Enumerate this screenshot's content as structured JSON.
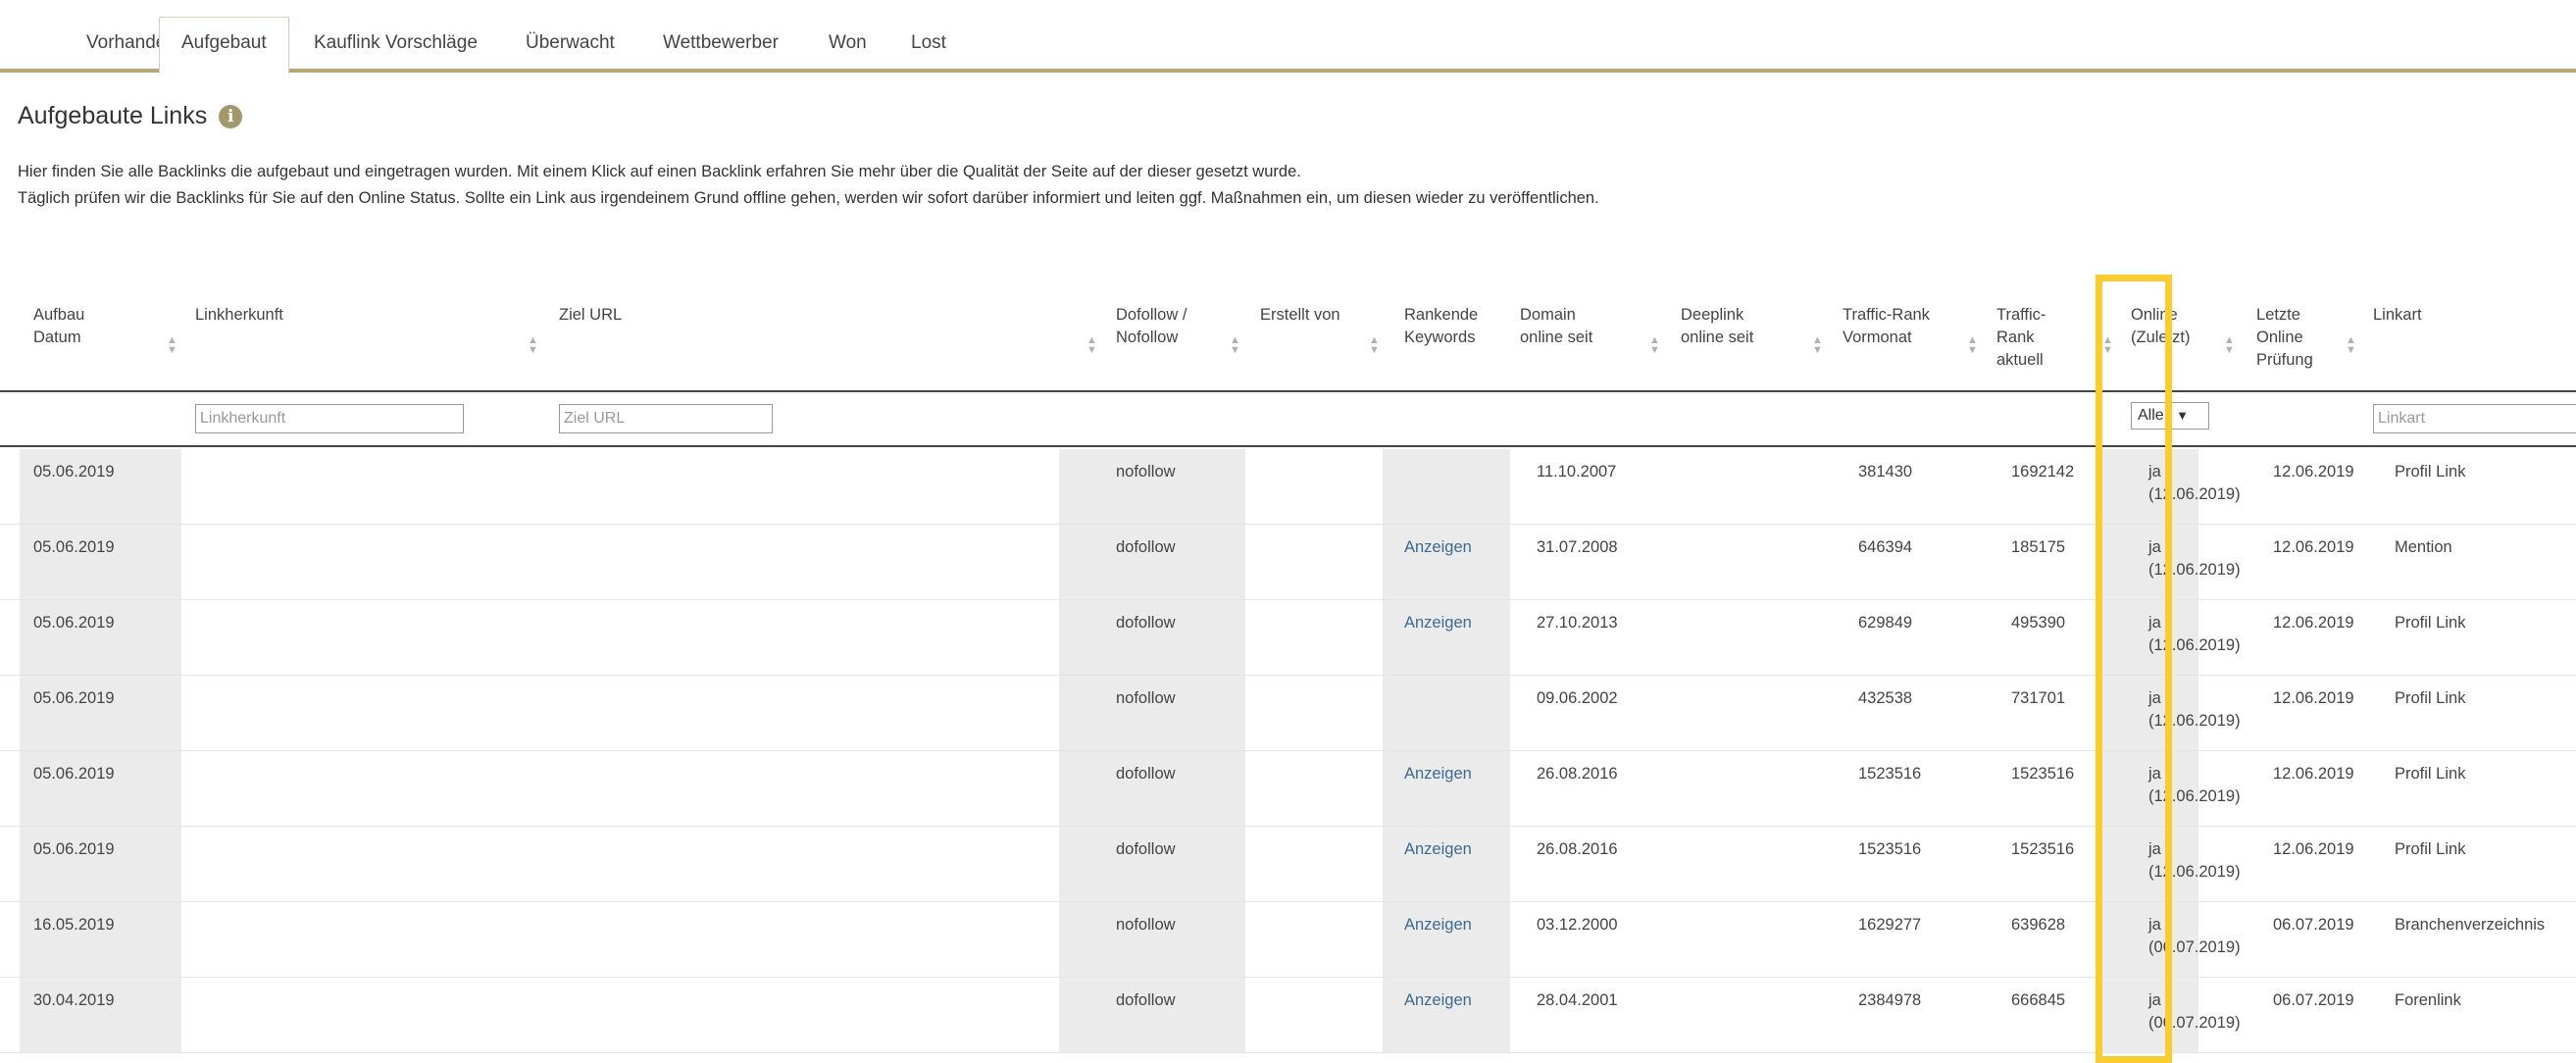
{
  "tabs": [
    {
      "label": "Vorhanden",
      "active": false
    },
    {
      "label": "Aufgebaut",
      "active": true
    },
    {
      "label": "Kauflink Vorschläge",
      "active": false
    },
    {
      "label": "Überwacht",
      "active": false
    },
    {
      "label": "Wettbewerber",
      "active": false
    },
    {
      "label": "Won",
      "active": false
    },
    {
      "label": "Lost",
      "active": false
    }
  ],
  "page": {
    "title": "Aufgebaute Links",
    "info_icon": "info-icon",
    "description_line1": "Hier finden Sie alle Backlinks die aufgebaut und eingetragen wurden. Mit einem Klick auf einen Backlink erfahren Sie mehr über die Qualität der Seite auf der dieser gesetzt wurde.",
    "description_line2": "Täglich prüfen wir die Backlinks für Sie auf den Online Status. Sollte ein Link aus irgendeinem Grund offline gehen, werden wir sofort darüber informiert und leiten ggf. Maßnahmen ein, um diesen wieder zu veröffentlichen."
  },
  "columns": [
    {
      "key": "aufbau",
      "label": "Aufbau\nDatum"
    },
    {
      "key": "herkunft",
      "label": "Linkherkunft"
    },
    {
      "key": "ziel",
      "label": "Ziel URL"
    },
    {
      "key": "follow",
      "label": "Dofollow /\nNofollow"
    },
    {
      "key": "erstellt",
      "label": "Erstellt von"
    },
    {
      "key": "keywords",
      "label": "Rankende\nKeywords"
    },
    {
      "key": "domain",
      "label": "Domain\nonline seit"
    },
    {
      "key": "deeplink",
      "label": "Deeplink\nonline seit"
    },
    {
      "key": "tr_vormonat",
      "label": "Traffic-Rank\nVormonat"
    },
    {
      "key": "tr_aktuell",
      "label": "Traffic-\nRank\naktuell"
    },
    {
      "key": "online",
      "label": "Online\n(Zuletzt)"
    },
    {
      "key": "pruefung",
      "label": "Letzte\nOnline\nPrüfung"
    },
    {
      "key": "linkart",
      "label": "Linkart"
    }
  ],
  "filters": {
    "herkunft_placeholder": "Linkherkunft",
    "ziel_placeholder": "Ziel URL",
    "online_selected": "Alle",
    "linkart_placeholder": "Linkart"
  },
  "rows": [
    {
      "aufbau": "05.06.2019",
      "follow": "nofollow",
      "keywords": "",
      "domain": "11.10.2007",
      "tr_vormonat": "381430",
      "tr_aktuell": "1692142",
      "online": "ja\n(12.06.2019)",
      "pruefung": "12.06.2019",
      "linkart": "Profil Link"
    },
    {
      "aufbau": "05.06.2019",
      "follow": "dofollow",
      "keywords": "Anzeigen",
      "domain": "31.07.2008",
      "tr_vormonat": "646394",
      "tr_aktuell": "185175",
      "online": "ja\n(12.06.2019)",
      "pruefung": "12.06.2019",
      "linkart": "Mention"
    },
    {
      "aufbau": "05.06.2019",
      "follow": "dofollow",
      "keywords": "Anzeigen",
      "domain": "27.10.2013",
      "tr_vormonat": "629849",
      "tr_aktuell": "495390",
      "online": "ja\n(12.06.2019)",
      "pruefung": "12.06.2019",
      "linkart": "Profil Link"
    },
    {
      "aufbau": "05.06.2019",
      "follow": "nofollow",
      "keywords": "",
      "domain": "09.06.2002",
      "tr_vormonat": "432538",
      "tr_aktuell": "731701",
      "online": "ja\n(12.06.2019)",
      "pruefung": "12.06.2019",
      "linkart": "Profil Link"
    },
    {
      "aufbau": "05.06.2019",
      "follow": "dofollow",
      "keywords": "Anzeigen",
      "domain": "26.08.2016",
      "tr_vormonat": "1523516",
      "tr_aktuell": "1523516",
      "online": "ja\n(12.06.2019)",
      "pruefung": "12.06.2019",
      "linkart": "Profil Link"
    },
    {
      "aufbau": "05.06.2019",
      "follow": "dofollow",
      "keywords": "Anzeigen",
      "domain": "26.08.2016",
      "tr_vormonat": "1523516",
      "tr_aktuell": "1523516",
      "online": "ja\n(12.06.2019)",
      "pruefung": "12.06.2019",
      "linkart": "Profil Link"
    },
    {
      "aufbau": "16.05.2019",
      "follow": "nofollow",
      "keywords": "Anzeigen",
      "domain": "03.12.2000",
      "tr_vormonat": "1629277",
      "tr_aktuell": "639628",
      "online": "ja\n(06.07.2019)",
      "pruefung": "06.07.2019",
      "linkart": "Branchenverzeichnis"
    },
    {
      "aufbau": "30.04.2019",
      "follow": "dofollow",
      "keywords": "Anzeigen",
      "domain": "28.04.2001",
      "tr_vormonat": "2384978",
      "tr_aktuell": "666845",
      "online": "ja\n(06.07.2019)",
      "pruefung": "06.07.2019",
      "linkart": "Forenlink"
    }
  ],
  "colors": {
    "accent_border": "#b5a878",
    "highlight": "#f9cd2e",
    "link": "#3d6a91",
    "row_shade": "#ebebeb"
  }
}
